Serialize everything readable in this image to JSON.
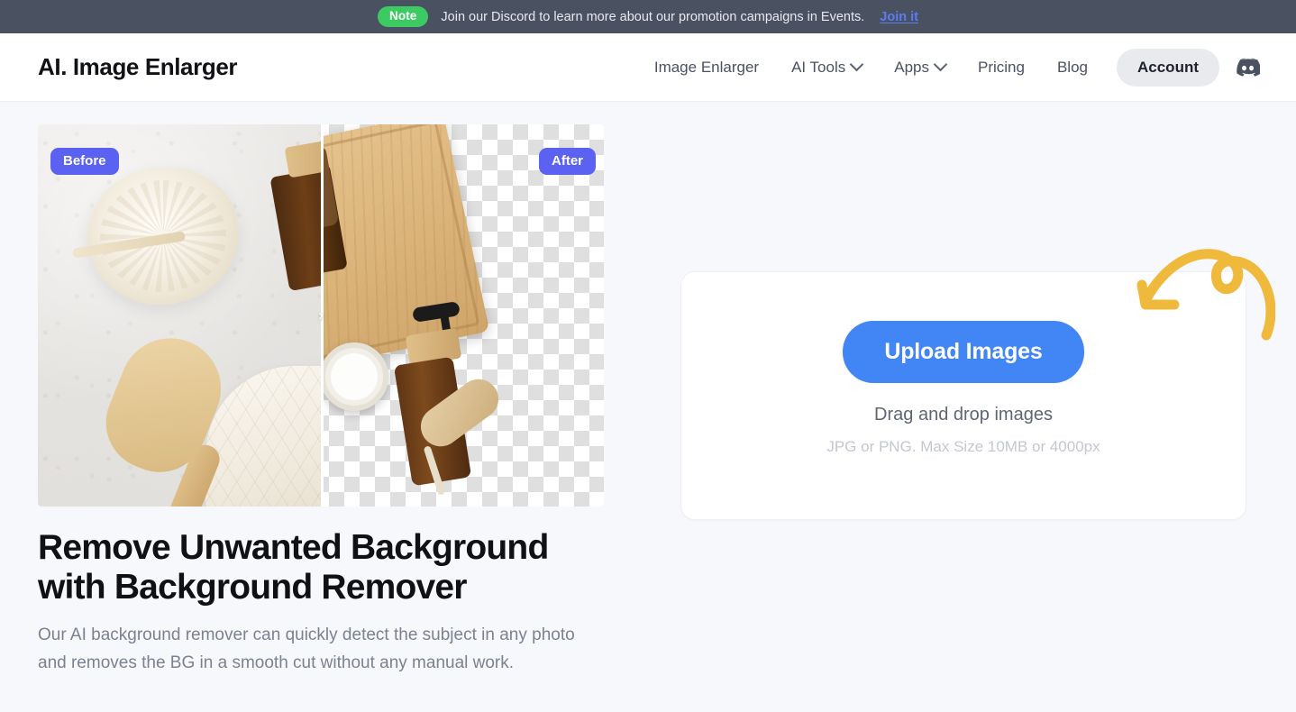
{
  "notice": {
    "badge": "Note",
    "text": "Join our Discord to learn more about our promotion campaigns in Events.",
    "link_label": "Join it",
    "badge_color": "#3ccb62",
    "bar_color": "#4a5160",
    "link_color": "#5b7cf5"
  },
  "header": {
    "logo": "AI. Image Enlarger",
    "nav": [
      {
        "label": "Image Enlarger",
        "has_dropdown": false
      },
      {
        "label": "AI Tools",
        "has_dropdown": true,
        "icon": "chevron-down-icon"
      },
      {
        "label": "Apps",
        "has_dropdown": true,
        "icon": "chevron-down-icon"
      },
      {
        "label": "Pricing",
        "has_dropdown": false
      },
      {
        "label": "Blog",
        "has_dropdown": false
      }
    ],
    "account_label": "Account",
    "discord_icon": "discord-icon"
  },
  "showcase": {
    "before_label": "Before",
    "after_label": "After",
    "slider_handle_icon": "chevron-right-icon",
    "badge_color": "#5b61f0",
    "title": "Remove Unwanted Background with Background Remover",
    "description": "Our AI background remover can quickly detect the subject in any photo and removes the BG in a smooth cut without any manual work."
  },
  "upload": {
    "button_label": "Upload Images",
    "drag_text": "Drag and drop images",
    "hint_text": "JPG or PNG. Max Size 10MB or 4000px",
    "button_color": "#4285f4",
    "arrow_icon": "curved-arrow-icon",
    "arrow_color": "#efb93c"
  }
}
